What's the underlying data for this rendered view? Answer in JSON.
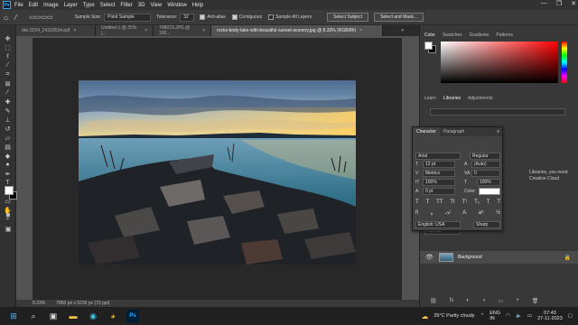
{
  "app": {
    "logo": "Ps"
  },
  "menu": [
    "File",
    "Edit",
    "Image",
    "Layer",
    "Type",
    "Select",
    "Filter",
    "3D",
    "View",
    "Window",
    "Help"
  ],
  "window_controls": [
    "—",
    "❐",
    "✕"
  ],
  "options": {
    "sample_size_label": "Sample Size:",
    "sample_size_value": "Point Sample",
    "tolerance_label": "Tolerance:",
    "tolerance_value": "32",
    "anti_alias": "Anti-alias",
    "contiguous": "Contiguous",
    "sample_all_layers": "Sample All Layers",
    "select_subject": "Select Subject",
    "select_and_mask": "Select and Mask..."
  },
  "tabs": [
    {
      "label": "dar-2024_24318534.pdf",
      "active": false
    },
    {
      "label": "Untitled-1 @ 25% (...",
      "active": false
    },
    {
      "label": "748073.JPG @ 100...",
      "active": false
    },
    {
      "label": "rocks-body-lake-with-beautiful-sunset-scenery.jpg @ 8.33% (RGB/8#)",
      "active": true
    }
  ],
  "status": {
    "zoom": "8.33%",
    "size": "7850 px x 5236 px (72 ppi)"
  },
  "color_panel": {
    "tabs": [
      "Color",
      "Swatches",
      "Gradients",
      "Patterns"
    ]
  },
  "libraries_panel": {
    "tabs": [
      "Learn",
      "Libraries",
      "Adjustments"
    ],
    "text_lines": [
      "Libraries, you need",
      "Creative Cloud"
    ]
  },
  "character": {
    "tabs": [
      "Character",
      "Paragraph"
    ],
    "font_family": "Arial",
    "font_style": "Regular",
    "font_size": "12 pt",
    "leading": "(Auto)",
    "kerning": "Metrics",
    "tracking": "0",
    "vertical_scale": "100%",
    "horizontal_scale": "100%",
    "baseline": "0 pt",
    "color_label": "Color:",
    "language": "English: USA",
    "antialias": "Sharp",
    "style_buttons": [
      "T",
      "T",
      "TT",
      "Tt",
      "T¹",
      "T₁",
      "T",
      "T"
    ]
  },
  "layers": {
    "blend": "Normal",
    "layer_name": "Background"
  },
  "taskbar": {
    "weather": "25°C  Partly cloudy",
    "lang": "ENG\nIN",
    "time": "07:43",
    "date": "27-11-2023"
  }
}
